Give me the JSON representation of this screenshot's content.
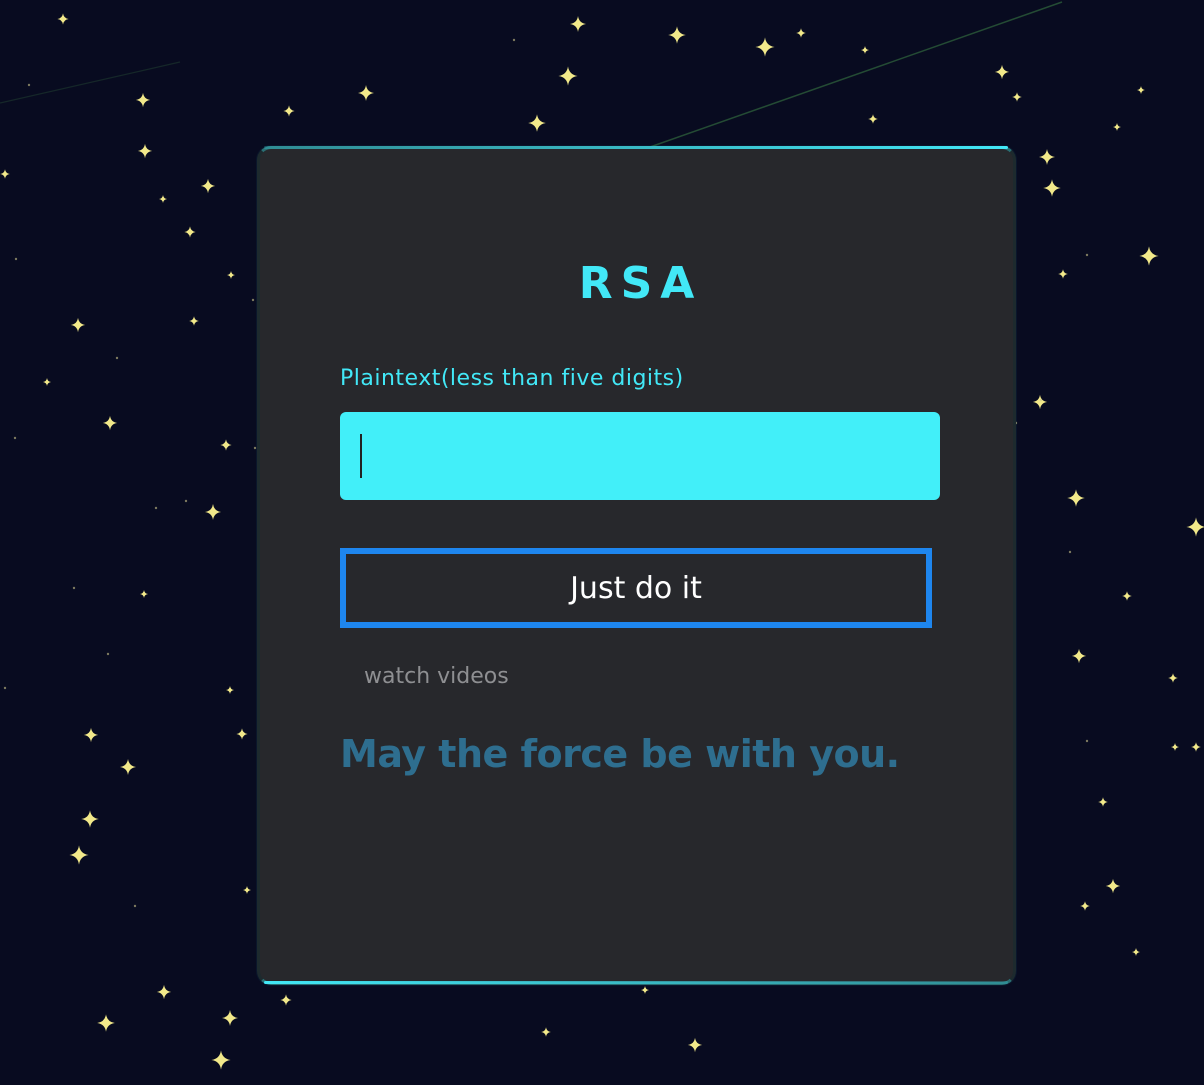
{
  "app": {
    "title": "RSA"
  },
  "form": {
    "plaintext_label": "Plaintext(less than five digits)",
    "plaintext_value": "",
    "submit_label": "Just do it",
    "link_label": "watch videos"
  },
  "footer": {
    "quote": "May the force be with you."
  },
  "colors": {
    "accent": "#42e8f7",
    "button_border": "#1e86ee",
    "card_background": "#27282c",
    "page_background": "#080b20",
    "star": "#f2e98a",
    "quote": "#2e6e8f"
  }
}
